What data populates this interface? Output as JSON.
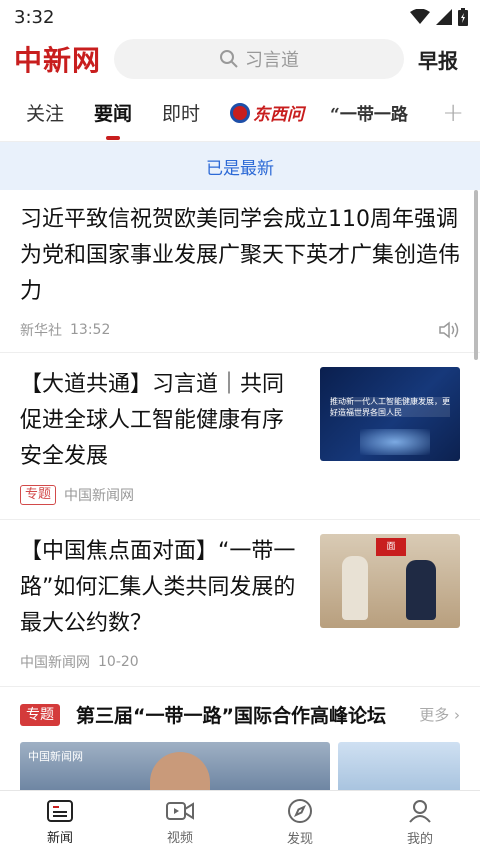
{
  "status": {
    "time": "3:32"
  },
  "header": {
    "logo": "中新网",
    "search_placeholder": "习言道",
    "morning_label": "早报"
  },
  "tabs": [
    {
      "label": "关注"
    },
    {
      "label": "要闻"
    },
    {
      "label": "即时"
    },
    {
      "label": "东西问"
    },
    {
      "label": "“一带一路"
    }
  ],
  "refresh_banner": "已是最新",
  "articles": [
    {
      "title": "习近平致信祝贺欧美同学会成立110周年强调 为党和国家事业发展广聚天下英才广集创造伟力",
      "source": "新华社",
      "time": "13:52"
    },
    {
      "title": "【大道共通】习言道｜共同促进全球人工智能健康有序安全发展",
      "tag": "专题",
      "source": "中国新闻网",
      "thumb_caption": "推动新一代人工智能健康发展，更好造福世界各国人民"
    },
    {
      "title": "【中国焦点面对面】“一带一路”如何汇集人类共同发展的最大公约数？",
      "source": "中国新闻网",
      "time": "10-20",
      "thumb_caption": "面"
    }
  ],
  "special": {
    "tag": "专题",
    "title": "第三届“一带一路”国际合作高峰论坛",
    "more": "更多",
    "watermark": "中国新闻网"
  },
  "nav": [
    {
      "label": "新闻",
      "icon": "news-icon"
    },
    {
      "label": "视频",
      "icon": "video-icon"
    },
    {
      "label": "发现",
      "icon": "compass-icon"
    },
    {
      "label": "我的",
      "icon": "profile-icon"
    }
  ],
  "colors": {
    "brand": "#c81e1e",
    "accent_blue": "#2d6ad6"
  }
}
